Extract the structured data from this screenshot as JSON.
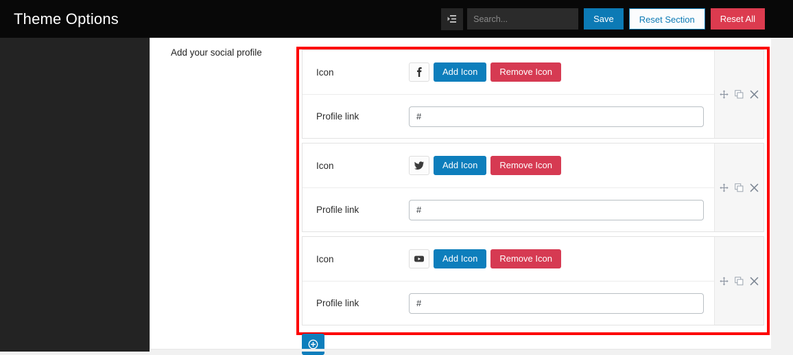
{
  "header": {
    "title": "Theme Options",
    "expand_icon": "collapse-list-icon",
    "search": {
      "value": "",
      "placeholder": "Search..."
    },
    "buttons": {
      "save": "Save",
      "reset_section": "Reset Section",
      "reset_all": "Reset All"
    },
    "colors": {
      "bar_background": "#080808",
      "primary_blue": "#0c7ab5",
      "danger_red": "#dc3b4f"
    }
  },
  "sidebar": {
    "background": "#232323"
  },
  "field": {
    "label": "Add your social profile",
    "highlight_color": "#fd0000"
  },
  "repeater": {
    "row_labels": {
      "icon": "Icon",
      "profile_link": "Profile link"
    },
    "buttons": {
      "add_icon": "Add Icon",
      "remove_icon": "Remove Icon"
    },
    "link_placeholder": "",
    "controls": [
      "move-icon",
      "duplicate-icon",
      "close-icon"
    ],
    "add_row_label": "",
    "add_row_icon": "plus-circle-icon",
    "groups": [
      {
        "icon_name": "facebook-icon",
        "profile_link": "#"
      },
      {
        "icon_name": "twitter-icon",
        "profile_link": "#"
      },
      {
        "icon_name": "youtube-icon",
        "profile_link": "#"
      }
    ]
  }
}
